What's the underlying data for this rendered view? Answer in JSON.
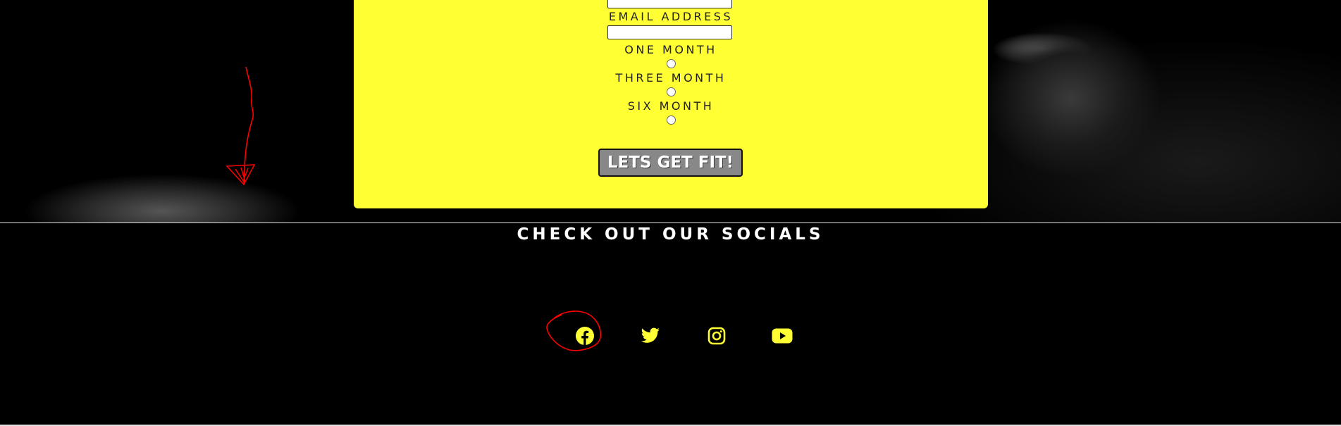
{
  "form": {
    "email_label": "EMAIL ADDRESS",
    "email_value": "",
    "plans": [
      {
        "label": "ONE MONTH",
        "selected": false
      },
      {
        "label": "THREE MONTH",
        "selected": false
      },
      {
        "label": "SIX MONTH",
        "selected": false
      }
    ],
    "submit_label": "LETS GET FIT!",
    "card_color": "#ffff33"
  },
  "footer": {
    "title": "CHECK OUT OUR SOCIALS",
    "icons": [
      "facebook-icon",
      "twitter-icon",
      "instagram-icon",
      "youtube-icon"
    ],
    "icon_color": "#ffff33"
  },
  "annotations": {
    "color": "#ff0000",
    "marks": [
      "arrow",
      "circle-around-facebook"
    ]
  }
}
